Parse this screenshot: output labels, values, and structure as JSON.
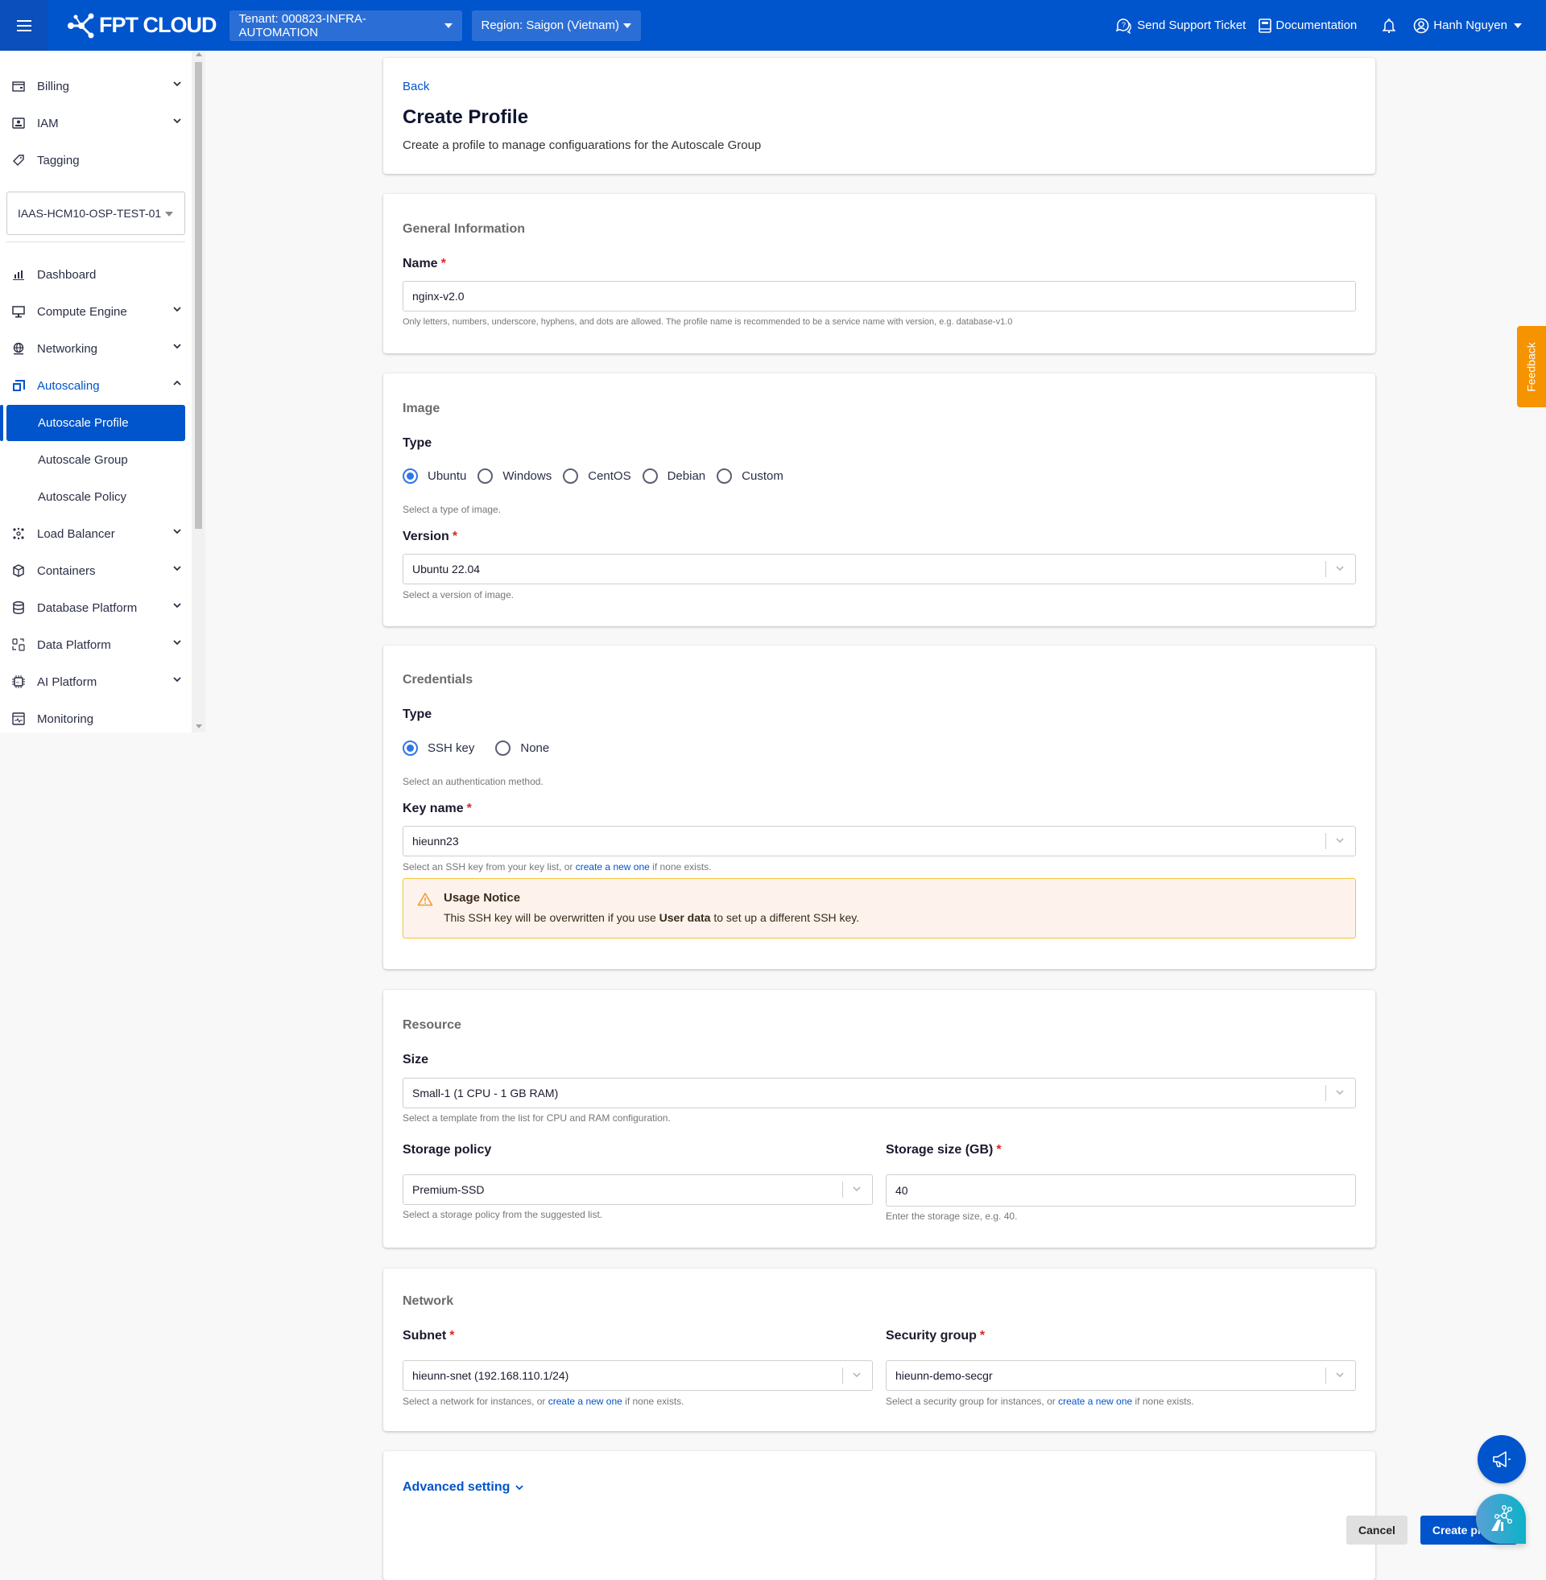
{
  "topbar": {
    "brand": "FPT CLOUD",
    "tenant": "Tenant: 000823-INFRA-AUTOMATION",
    "region": "Region: Saigon (Vietnam)",
    "support": "Send Support Ticket",
    "docs": "Documentation",
    "user": "Hanh Nguyen"
  },
  "sidebar": {
    "project": "IAAS-HCM10-OSP-TEST-01",
    "items": [
      {
        "label": "Billing"
      },
      {
        "label": "IAM"
      },
      {
        "label": "Tagging"
      },
      {
        "label": "Dashboard"
      },
      {
        "label": "Compute Engine"
      },
      {
        "label": "Networking"
      },
      {
        "label": "Autoscaling"
      },
      {
        "label": "Load Balancer"
      },
      {
        "label": "Containers"
      },
      {
        "label": "Database Platform"
      },
      {
        "label": "Data Platform"
      },
      {
        "label": "AI Platform"
      },
      {
        "label": "Monitoring"
      }
    ],
    "autoscaling_sub": [
      {
        "label": "Autoscale Profile",
        "active": true
      },
      {
        "label": "Autoscale Group"
      },
      {
        "label": "Autoscale Policy"
      }
    ]
  },
  "header": {
    "back": "Back",
    "title": "Create Profile",
    "subtitle": "Create a profile to manage configuarations for the Autoscale Group"
  },
  "general": {
    "title": "General Information",
    "name_label": "Name",
    "name_value": "nginx-v2.0",
    "name_hint": "Only letters, numbers, underscore, hyphens, and dots are allowed. The profile name is recommended to be a service name with version, e.g. database-v1.0"
  },
  "image": {
    "title": "Image",
    "type_label": "Type",
    "types": [
      "Ubuntu",
      "Windows",
      "CentOS",
      "Debian",
      "Custom"
    ],
    "selected_type": "Ubuntu",
    "type_hint": "Select a type of image.",
    "version_label": "Version",
    "version_value": "Ubuntu 22.04",
    "version_hint": "Select a version of image."
  },
  "credentials": {
    "title": "Credentials",
    "type_label": "Type",
    "types": [
      "SSH key",
      "None"
    ],
    "selected_type": "SSH key",
    "type_hint": "Select an authentication method.",
    "key_label": "Key name",
    "key_value": "hieunn23",
    "key_hint_pre": "Select an SSH key from your key list, or ",
    "key_hint_link": "create a new one",
    "key_hint_post": " if none exists.",
    "notice_title": "Usage Notice",
    "notice_pre": "This SSH key will be overwritten if you use ",
    "notice_bold": "User data",
    "notice_post": " to set up a different SSH key."
  },
  "resource": {
    "title": "Resource",
    "size_label": "Size",
    "size_value": "Small-1 (1 CPU - 1 GB RAM)",
    "size_hint": "Select a template from the list for CPU and RAM configuration.",
    "policy_label": "Storage policy",
    "policy_value": "Premium-SSD",
    "policy_hint": "Select a storage policy from the suggested list.",
    "storage_label": "Storage size (GB)",
    "storage_value": "40",
    "storage_hint": "Enter the storage size, e.g. 40."
  },
  "network": {
    "title": "Network",
    "subnet_label": "Subnet",
    "subnet_value": "hieunn-snet (192.168.110.1/24)",
    "subnet_hint_pre": "Select a network for instances, or ",
    "subnet_hint_link": "create a new one",
    "subnet_hint_post": " if none exists.",
    "secgroup_label": "Security group",
    "secgroup_value": "hieunn-demo-secgr",
    "secgroup_hint_pre": "Select a security group for instances, or ",
    "secgroup_hint_link": "create a new one",
    "secgroup_hint_post": " if none exists."
  },
  "footer": {
    "advanced": "Advanced setting",
    "cancel": "Cancel",
    "create": "Create profile"
  },
  "widgets": {
    "feedback": "Feedback"
  },
  "colors": {
    "brand": "#0054cc",
    "feedback": "#f59300",
    "required": "#e02424",
    "notice_bg": "#fdf3ec",
    "notice_border": "#f4c23a"
  }
}
